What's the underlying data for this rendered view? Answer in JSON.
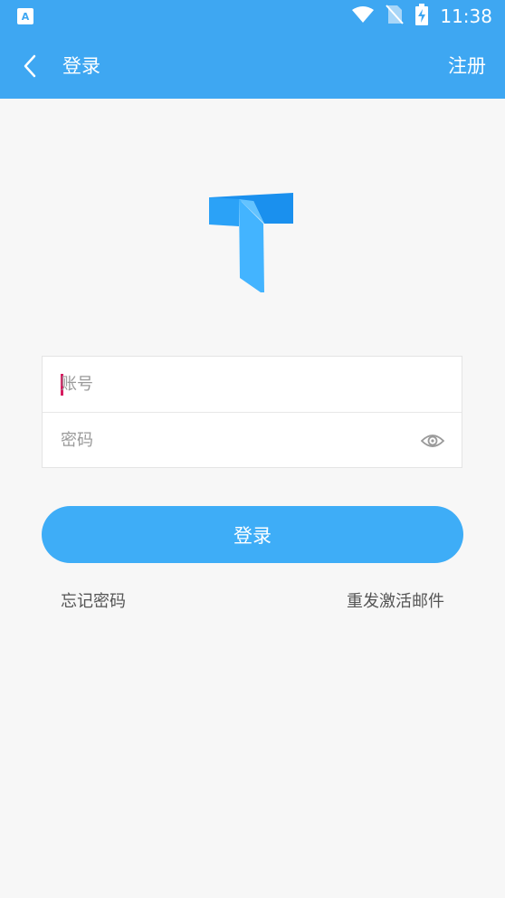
{
  "status_bar": {
    "time": "11:38",
    "icons": [
      "app-notification-icon",
      "wifi-icon",
      "no-sim-icon",
      "battery-charging-icon"
    ]
  },
  "app_bar": {
    "back_icon": "chevron-left-icon",
    "title": "登录",
    "register_label": "注册"
  },
  "logo": {
    "icon": "t-logo-icon",
    "colors": {
      "top": "#1a90ee",
      "stem": "#43b4ff",
      "fold": "#63c3ff"
    }
  },
  "form": {
    "account": {
      "placeholder": "账号",
      "value": ""
    },
    "password": {
      "placeholder": "密码",
      "value": "",
      "toggle_icon": "eye-icon"
    }
  },
  "login_button": {
    "label": "登录"
  },
  "links": {
    "forgot_password": "忘记密码",
    "resend_activation": "重发激活邮件"
  },
  "colors": {
    "primary": "#3ea7f2",
    "button": "#3eadf7",
    "background": "#f7f7f7",
    "cursor": "#d81b60"
  }
}
